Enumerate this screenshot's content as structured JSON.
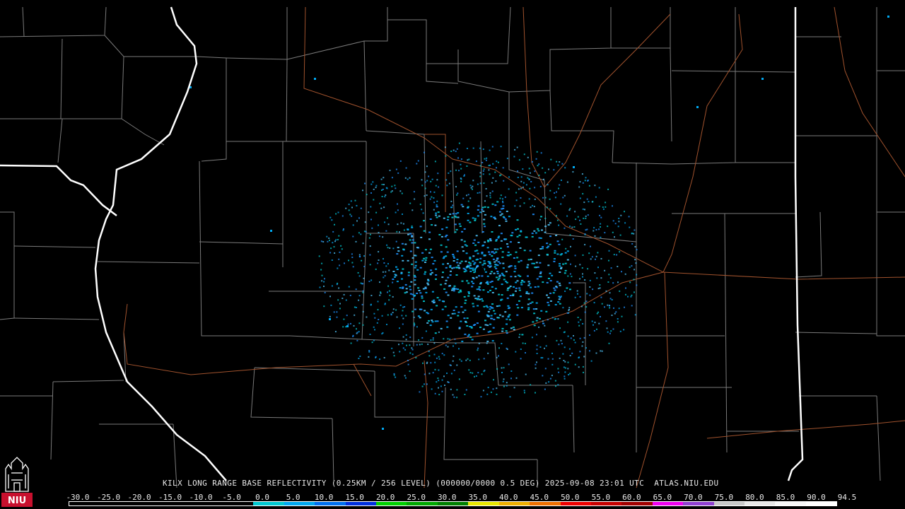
{
  "product": {
    "caption": "KILX LONG RANGE BASE REFLECTIVITY (0.25KM / 256 LEVEL) (000000/0000 0.5 DEG) 2025-09-08 23:01 UTC  ATLAS.NIU.EDU"
  },
  "colorbar": {
    "ticks": [
      "-30.0",
      "-25.0",
      "-20.0",
      "-15.0",
      "-10.0",
      "-5.0",
      "0.0",
      "5.0",
      "10.0",
      "15.0",
      "20.0",
      "25.0",
      "30.0",
      "35.0",
      "40.0",
      "45.0",
      "50.0",
      "55.0",
      "60.0",
      "65.0",
      "70.0",
      "75.0",
      "80.0",
      "85.0",
      "90.0",
      "94.5"
    ],
    "colors": [
      "#000000",
      "#000000",
      "#000000",
      "#000000",
      "#000000",
      "#000000",
      "#00c8d0",
      "#00a8f0",
      "#0070f0",
      "#0030e0",
      "#00d000",
      "#00a800",
      "#008000",
      "#e8e800",
      "#f0b000",
      "#f07000",
      "#f00000",
      "#c80000",
      "#a00000",
      "#f000f0",
      "#9040d0",
      "#c8c8c8",
      "#e8e8e8",
      "#f8f8f8",
      "#ffffff"
    ]
  },
  "logo": {
    "text": "NIU",
    "colors": {
      "red": "#c8102e",
      "white": "#ffffff"
    }
  },
  "map": {
    "background": "#000000",
    "county_line_color": "#7a7a7a",
    "highway_color": "#a0522d",
    "state_border_color": "#ffffff",
    "echo_colors": [
      "#00c8d0",
      "#00a8f0",
      "#1e90ff",
      "#4fc3f7"
    ]
  }
}
